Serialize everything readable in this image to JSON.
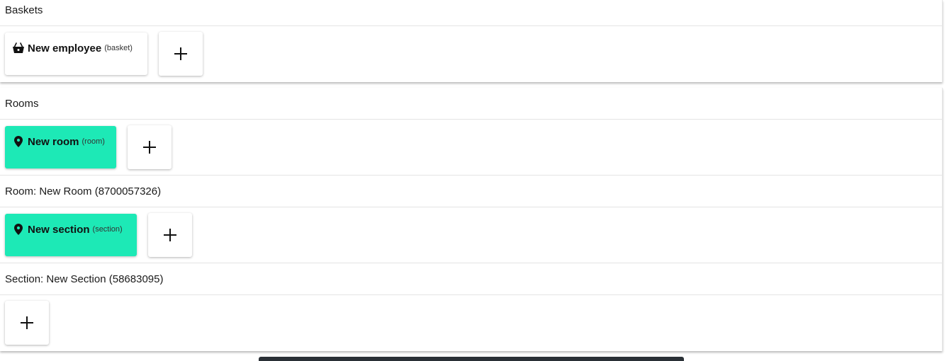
{
  "baskets": {
    "header": "Baskets",
    "items": [
      {
        "title": "New employee",
        "type": "(basket)",
        "icon": "basket-icon"
      }
    ],
    "add_label": "+"
  },
  "rooms": {
    "header": "Rooms",
    "items": [
      {
        "title": "New room",
        "type": "(room)",
        "icon": "location-pin-icon",
        "selected": true
      }
    ],
    "room_header": "Room: New Room (8700057326)",
    "sections": [
      {
        "title": "New section",
        "type": "(section)",
        "icon": "location-pin-icon",
        "selected": true
      }
    ],
    "section_header": "Section: New Section (58683095)"
  },
  "colors": {
    "selected": "#1de9b6",
    "card": "#ffffff",
    "bottom_bar": "#2a3036"
  }
}
